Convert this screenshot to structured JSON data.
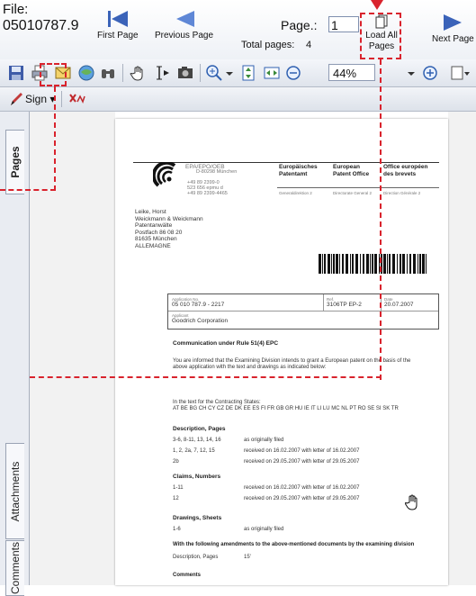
{
  "nav": {
    "file_label": "File:",
    "file_number": "05010787.9",
    "first_page": "First Page",
    "previous_page": "Previous Page",
    "page_label": "Page.:",
    "page_value": "1",
    "total_pages_label": "Total pages:",
    "total_pages_value": "4",
    "load_all_pages": "Load All Pages",
    "next_page": "Next Page"
  },
  "toolbar": {
    "zoom_value": "44%"
  },
  "signbar": {
    "sign_label": "Sign",
    "sign_arrow": "▾"
  },
  "sidepanel": {
    "tab_pages": "Pages",
    "tab_attachments": "Attachments",
    "tab_comments": "Comments"
  },
  "document": {
    "header_codes": [
      "EPA/EPO/OEB",
      "D-80298 München"
    ],
    "phone_lines": [
      "+49 89 2399-0",
      "523 656 epmu d",
      "+49 89 2399-4465"
    ],
    "office_de": [
      "Europäisches",
      "Patentamt"
    ],
    "office_en": [
      "European",
      "Patent Office"
    ],
    "office_fr": [
      "Office européen",
      "des brevets"
    ],
    "office_sub": [
      "Generaldirektion 2",
      "Directorate General 2",
      "Direction Générale 2"
    ],
    "address": [
      "Leike, Horst",
      "Weickmann & Weickmann",
      "Patentanwälte",
      "Postfach 86 08 20",
      "81635 München",
      "ALLEMAGNE"
    ],
    "app_no_label": "Application No.",
    "app_no": "05 010 787.9 - 2217",
    "ref_label": "Ref.",
    "ref": "3106TP EP-2",
    "date_label": "Date",
    "date": "20.07.2007",
    "applicant_label": "Applicant",
    "applicant": "Goodrich Corporation",
    "comm_title": "Communication under Rule 51(4) EPC",
    "comm_text_1": "You are informed that the Examining Division intends to grant a European patent on the basis of the",
    "comm_text_2": "above application with the text and drawings as indicated below:",
    "states_label": "In the text for the Contracting States:",
    "states": "AT BE BG CH CY CZ DE DK EE ES FI FR GB GR HU IE IT LI LU MC NL PT RO SE SI SK TR",
    "desc_title": "Description, Pages",
    "desc_rows": [
      {
        "a": "3-6, 8-11, 13, 14, 16",
        "b": "as originally filed"
      },
      {
        "a": "1, 2, 2a, 7, 12, 15",
        "b": "received on 16.02.2007 with letter of 16.02.2007"
      },
      {
        "a": "2b",
        "b": "received on 29.05.2007 with letter of 29.05.2007"
      }
    ],
    "claims_title": "Claims, Numbers",
    "claims_rows": [
      {
        "a": "1-11",
        "b": "received on 16.02.2007 with letter of 16.02.2007"
      },
      {
        "a": "12",
        "b": "received on 29.05.2007 with letter of 29.05.2007"
      }
    ],
    "draw_title": "Drawings, Sheets",
    "draw_rows": [
      {
        "a": "1-6",
        "b": "as originally filed"
      }
    ],
    "amend_title": "With the following amendments to the above-mentioned documents by the examining division",
    "amend_row_a": "Description, Pages",
    "amend_row_b": "15'",
    "comments_title": "Comments"
  },
  "colors": {
    "callout": "#d9232d",
    "nav_arrow": "#3b63b9"
  }
}
